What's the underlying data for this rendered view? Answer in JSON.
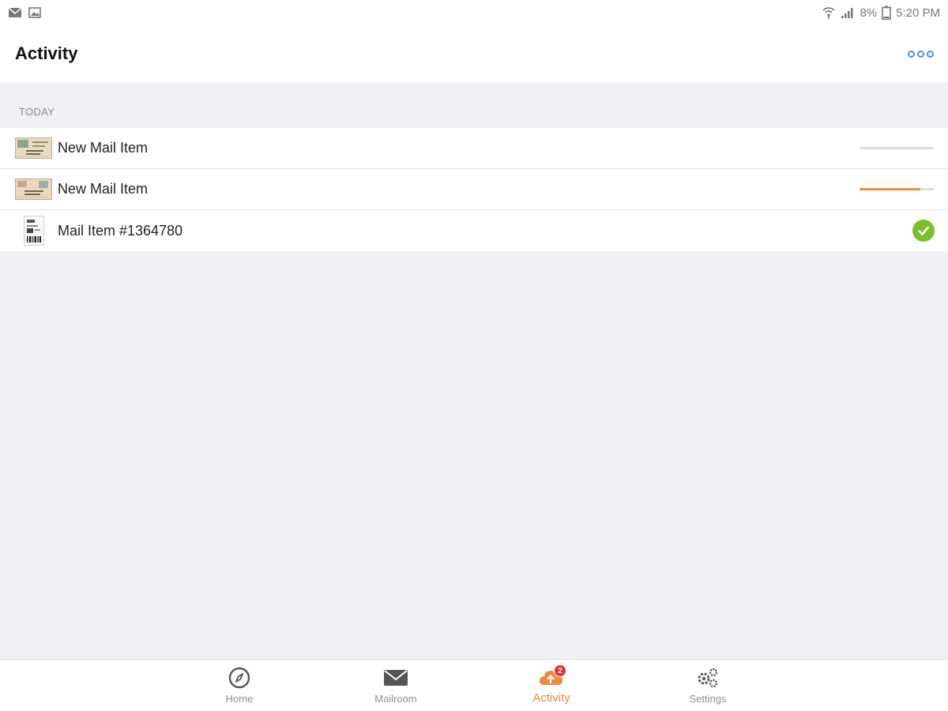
{
  "status_bar": {
    "left_icons": [
      "mail-notification-icon",
      "image-notification-icon"
    ],
    "right_icons": [
      "wifi-icon",
      "signal-icon",
      "battery-icon"
    ],
    "battery": "8%",
    "time": "5:20 PM"
  },
  "header": {
    "title": "Activity",
    "more_icon": "more-icon"
  },
  "section": {
    "label": "TODAY"
  },
  "items": [
    {
      "label": "New Mail Item",
      "thumb": "envelope-thumbnail",
      "status": "progress",
      "progress": 0.0
    },
    {
      "label": "New Mail Item",
      "thumb": "envelope-thumbnail",
      "status": "progress",
      "progress": 0.82
    },
    {
      "label": "Mail Item #1364780",
      "thumb": "document-thumbnail",
      "status": "done"
    }
  ],
  "tabs": [
    {
      "label": "Home",
      "icon": "compass-icon",
      "active": false
    },
    {
      "label": "Mailroom",
      "icon": "envelope-icon",
      "active": false
    },
    {
      "label": "Activity",
      "icon": "cloud-upload-icon",
      "active": true,
      "badge": "2"
    },
    {
      "label": "Settings",
      "icon": "gears-icon",
      "active": false
    }
  ],
  "colors": {
    "accent": "#f08a3c",
    "link": "#4a90e2",
    "success": "#7cbd2a",
    "badge": "#e8312f",
    "background": "#efeff4"
  }
}
